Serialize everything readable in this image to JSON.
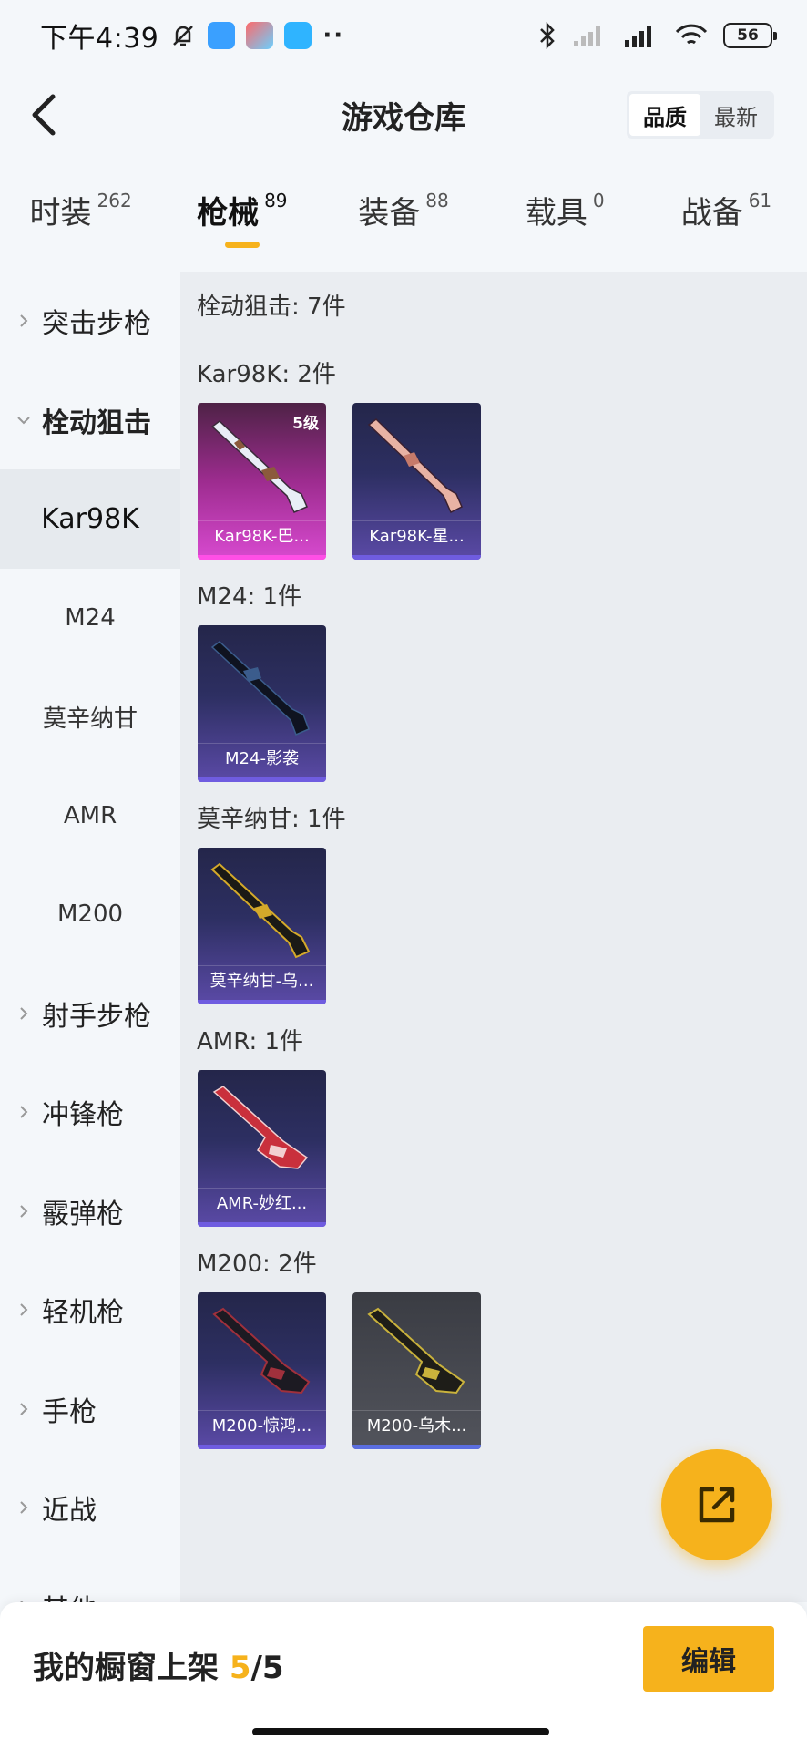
{
  "status_bar": {
    "time": "下午4:39",
    "more": "··",
    "battery": "56",
    "icons": [
      "mute-bell-icon",
      "wallet-app-icon",
      "game-app-icon",
      "chat-app-icon",
      "bluetooth-icon",
      "signal-icon",
      "hd-signal-icon",
      "wifi-icon"
    ]
  },
  "header": {
    "title": "游戏仓库",
    "sort_options": [
      "品质",
      "最新"
    ],
    "sort_active": "品质"
  },
  "tabs": [
    {
      "label": "时装",
      "count": "262"
    },
    {
      "label": "枪械",
      "count": "89",
      "active": true
    },
    {
      "label": "装备",
      "count": "88"
    },
    {
      "label": "载具",
      "count": "0"
    },
    {
      "label": "战备",
      "count": "61"
    }
  ],
  "sidebar": {
    "items": [
      {
        "label": "突击步枪",
        "type": "group"
      },
      {
        "label": "栓动狙击",
        "type": "group",
        "expanded": true
      },
      {
        "label": "Kar98K",
        "type": "sub",
        "active": true
      },
      {
        "label": "M24",
        "type": "sub"
      },
      {
        "label": "莫辛纳甘",
        "type": "sub"
      },
      {
        "label": "AMR",
        "type": "sub"
      },
      {
        "label": "M200",
        "type": "sub"
      },
      {
        "label": "射手步枪",
        "type": "group"
      },
      {
        "label": "冲锋枪",
        "type": "group"
      },
      {
        "label": "霰弹枪",
        "type": "group"
      },
      {
        "label": "轻机枪",
        "type": "group"
      },
      {
        "label": "手枪",
        "type": "group"
      },
      {
        "label": "近战",
        "type": "group"
      },
      {
        "label": "其他",
        "type": "group"
      }
    ]
  },
  "main": {
    "category_summary": "栓动狙击: 7件",
    "sections": [
      {
        "title": "Kar98K: 2件",
        "items": [
          {
            "name": "Kar98K-巴...",
            "badge": "5级",
            "rarity": "pink",
            "gun_color": "#e9eef6",
            "accent": "#8b5a3c"
          },
          {
            "name": "Kar98K-星...",
            "rarity": "blue",
            "gun_color": "#e8b2a4",
            "accent": "#c67a6a"
          }
        ]
      },
      {
        "title": "M24: 1件",
        "items": [
          {
            "name": "M24-影袭",
            "rarity": "blue",
            "gun_color": "#0f1320",
            "accent": "#3b5c8c"
          }
        ]
      },
      {
        "title": "莫辛纳甘: 1件",
        "items": [
          {
            "name": "莫辛纳甘-乌...",
            "rarity": "blue",
            "gun_color": "#1b1a16",
            "accent": "#d4a92a"
          }
        ]
      },
      {
        "title": "AMR: 1件",
        "items": [
          {
            "name": "AMR-妙红...",
            "rarity": "blue",
            "gun_color": "#c9303c",
            "accent": "#f2d0d0"
          }
        ]
      },
      {
        "title": "M200: 2件",
        "items": [
          {
            "name": "M200-惊鸿...",
            "rarity": "blue",
            "gun_color": "#1c1a22",
            "accent": "#a0303c"
          },
          {
            "name": "M200-乌木...",
            "rarity": "gray",
            "gun_color": "#1e1d18",
            "accent": "#c9b23c"
          }
        ]
      }
    ]
  },
  "bottom_bar": {
    "shelf_label": "我的橱窗上架",
    "shelf_current": "5",
    "shelf_total": "/5",
    "edit_label": "编辑"
  },
  "colors": {
    "accent": "#f6b21c",
    "rarity_blue": "#6f5ce0",
    "rarity_pink": "#ff4fe6"
  }
}
